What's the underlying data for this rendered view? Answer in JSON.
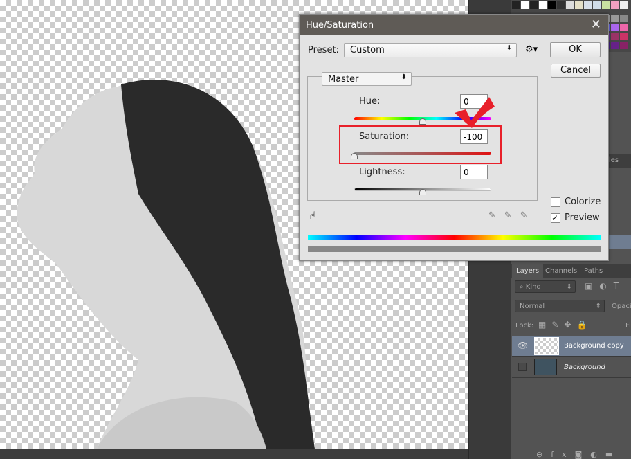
{
  "dialog": {
    "title": "Hue/Saturation",
    "preset_label": "Preset:",
    "preset_value": "Custom",
    "channel": "Master",
    "ok": "OK",
    "cancel": "Cancel",
    "hue": {
      "label": "Hue:",
      "value": "0"
    },
    "saturation": {
      "label": "Saturation:",
      "value": "-100"
    },
    "lightness": {
      "label": "Lightness:",
      "value": "0"
    },
    "colorize": {
      "label": "Colorize",
      "checked": false
    },
    "preview": {
      "label": "Preview",
      "checked": true
    },
    "highlight_color": "#e8202a"
  },
  "layers_panel": {
    "tabs": [
      "Layers",
      "Channels",
      "Paths"
    ],
    "filter": "Kind",
    "blend_mode": "Normal",
    "opacity_label": "Opacit",
    "lock_label": "Lock:",
    "fill_label": "Fi",
    "layers": [
      {
        "name": "Background copy",
        "visible": true,
        "selected": true
      },
      {
        "name": "Background",
        "visible": false,
        "selected": false
      }
    ]
  },
  "styles_tab": "yles"
}
